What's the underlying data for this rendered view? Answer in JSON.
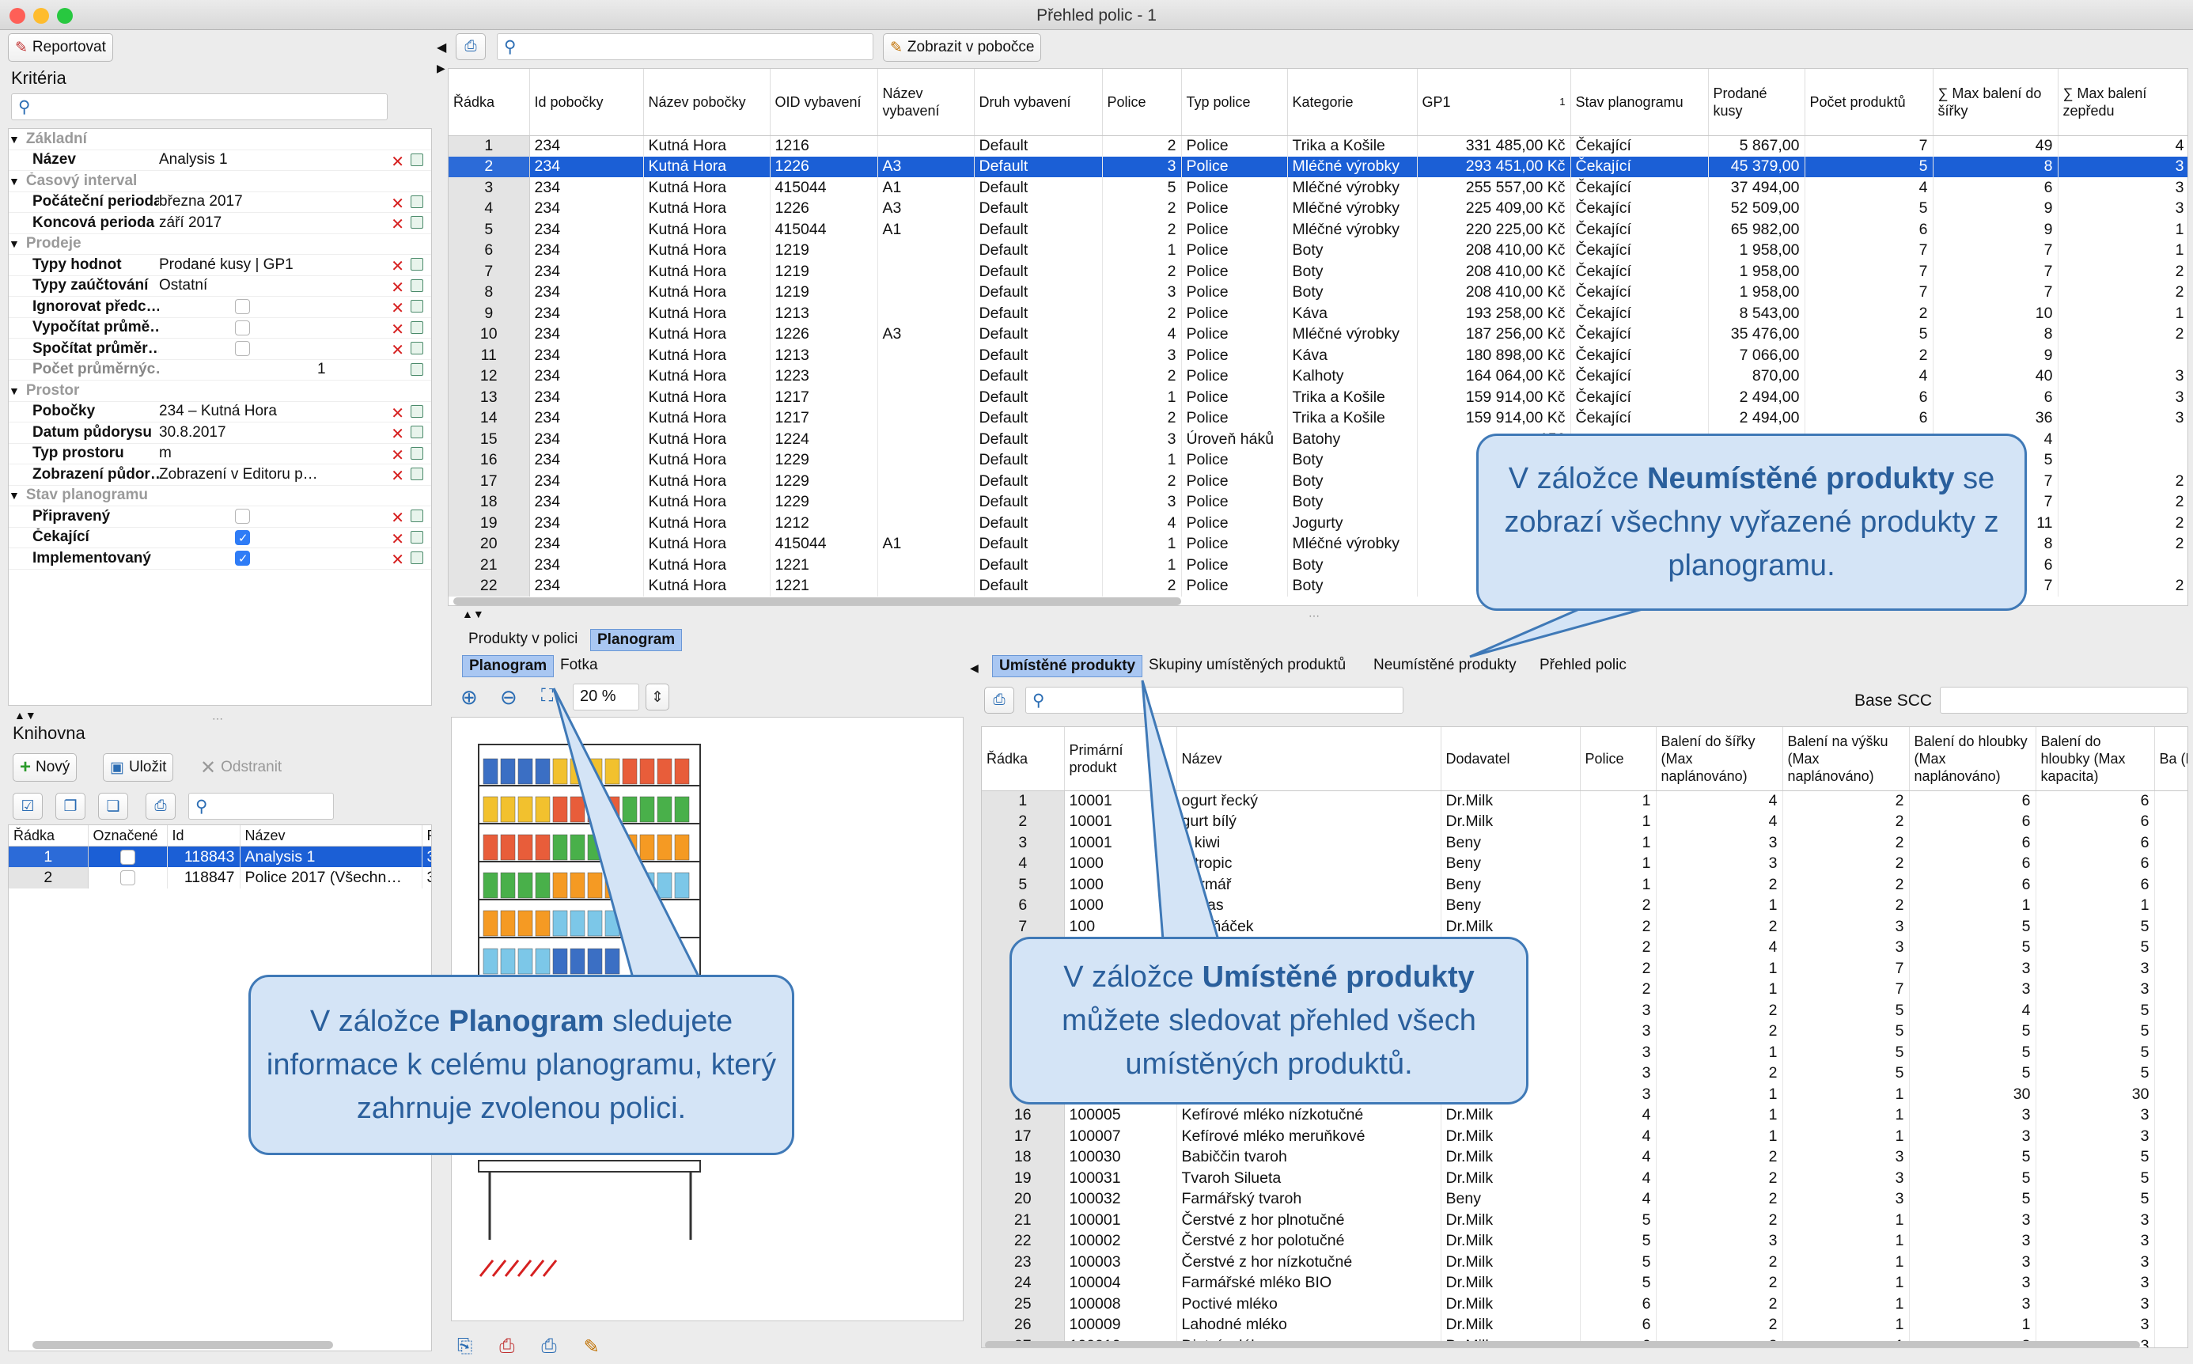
{
  "window": {
    "title": "Přehled polic - 1"
  },
  "toolbar": {
    "report_btn": "Reportovat",
    "show_in_branch": "Zobrazit v pobočce"
  },
  "criteria": {
    "title": "Kritéria",
    "rows": [
      {
        "type": "group",
        "label": "Základní"
      },
      {
        "type": "item",
        "label": "Název",
        "value": "Analysis 1"
      },
      {
        "type": "group",
        "label": "Časový interval"
      },
      {
        "type": "item",
        "label": "Počáteční perioda",
        "value": "března 2017"
      },
      {
        "type": "item",
        "label": "Koncová perioda",
        "value": "září 2017"
      },
      {
        "type": "group",
        "label": "Prodeje"
      },
      {
        "type": "item",
        "label": "Typy hodnot",
        "value": "Prodané kusy | GP1"
      },
      {
        "type": "item",
        "label": "Typy zaúčtování",
        "value": "Ostatní"
      },
      {
        "type": "item",
        "label": "Ignorovat předc…",
        "value": "",
        "checkbox": false
      },
      {
        "type": "item",
        "label": "Vypočítat průmě…",
        "value": "",
        "checkbox": false
      },
      {
        "type": "item",
        "label": "Spočítat průměr…",
        "value": "",
        "checkbox": false
      },
      {
        "type": "dim",
        "label": "Počet průměrnýc…",
        "value": "1"
      },
      {
        "type": "group",
        "label": "Prostor"
      },
      {
        "type": "item",
        "label": "Pobočky",
        "value": "234 – Kutná Hora"
      },
      {
        "type": "item",
        "label": "Datum půdorysu",
        "value": "30.8.2017"
      },
      {
        "type": "item",
        "label": "Typ prostoru",
        "value": "m"
      },
      {
        "type": "item",
        "label": "Zobrazení půdor…",
        "value": "Zobrazení v Editoru p…"
      },
      {
        "type": "group",
        "label": "Stav planogramu"
      },
      {
        "type": "item",
        "label": "Připravený",
        "value": "",
        "checkbox": false
      },
      {
        "type": "item",
        "label": "Čekající",
        "value": "",
        "checkbox": true
      },
      {
        "type": "item",
        "label": "Implementovaný",
        "value": "",
        "checkbox": true
      }
    ]
  },
  "library": {
    "title": "Knihovna",
    "new_btn": "Nový",
    "save_btn": "Uložit",
    "delete_btn": "Odstranit",
    "headers": [
      "Řádka",
      "Označené",
      "Id",
      "Název",
      "P"
    ],
    "rows": [
      {
        "n": "1",
        "id": "118843",
        "name": "Analysis 1",
        "p": "3"
      },
      {
        "n": "2",
        "id": "118847",
        "name": "Police 2017 (Všechn…",
        "p": "3"
      }
    ]
  },
  "main_table": {
    "headers": [
      "Řádka",
      "Id pobočky",
      "Název pobočky",
      "OID vybavení",
      "Název vybavení",
      "Druh vybavení",
      "Police",
      "Typ police",
      "Kategorie",
      "GP1",
      "Stav planogramu",
      "Prodané kusy",
      "Počet produktů",
      "∑ Max balení do šířky",
      "∑ Max balení zepředu"
    ],
    "gp1_sort": "1",
    "rows": [
      [
        "1",
        "234",
        "Kutná Hora",
        "1216",
        "",
        "Default",
        "2",
        "Police",
        "Trika a Košile",
        "331 485,00 Kč",
        "Čekající",
        "5 867,00",
        "7",
        "49",
        "4"
      ],
      [
        "2",
        "234",
        "Kutná Hora",
        "1226",
        "A3",
        "Default",
        "3",
        "Police",
        "Mléčné výrobky",
        "293 451,00 Kč",
        "Čekající",
        "45 379,00",
        "5",
        "8",
        "3"
      ],
      [
        "3",
        "234",
        "Kutná Hora",
        "415044",
        "A1",
        "Default",
        "5",
        "Police",
        "Mléčné výrobky",
        "255 557,00 Kč",
        "Čekající",
        "37 494,00",
        "4",
        "6",
        "3"
      ],
      [
        "4",
        "234",
        "Kutná Hora",
        "1226",
        "A3",
        "Default",
        "2",
        "Police",
        "Mléčné výrobky",
        "225 409,00 Kč",
        "Čekající",
        "52 509,00",
        "5",
        "9",
        "3"
      ],
      [
        "5",
        "234",
        "Kutná Hora",
        "415044",
        "A1",
        "Default",
        "2",
        "Police",
        "Mléčné výrobky",
        "220 225,00 Kč",
        "Čekající",
        "65 982,00",
        "6",
        "9",
        "1"
      ],
      [
        "6",
        "234",
        "Kutná Hora",
        "1219",
        "",
        "Default",
        "1",
        "Police",
        "Boty",
        "208 410,00 Kč",
        "Čekající",
        "1 958,00",
        "7",
        "7",
        "1"
      ],
      [
        "7",
        "234",
        "Kutná Hora",
        "1219",
        "",
        "Default",
        "2",
        "Police",
        "Boty",
        "208 410,00 Kč",
        "Čekající",
        "1 958,00",
        "7",
        "7",
        "2"
      ],
      [
        "8",
        "234",
        "Kutná Hora",
        "1219",
        "",
        "Default",
        "3",
        "Police",
        "Boty",
        "208 410,00 Kč",
        "Čekající",
        "1 958,00",
        "7",
        "7",
        "2"
      ],
      [
        "9",
        "234",
        "Kutná Hora",
        "1213",
        "",
        "Default",
        "2",
        "Police",
        "Káva",
        "193 258,00 Kč",
        "Čekající",
        "8 543,00",
        "2",
        "10",
        "1"
      ],
      [
        "10",
        "234",
        "Kutná Hora",
        "1226",
        "A3",
        "Default",
        "4",
        "Police",
        "Mléčné výrobky",
        "187 256,00 Kč",
        "Čekající",
        "35 476,00",
        "5",
        "8",
        "2"
      ],
      [
        "11",
        "234",
        "Kutná Hora",
        "1213",
        "",
        "Default",
        "3",
        "Police",
        "Káva",
        "180 898,00 Kč",
        "Čekající",
        "7 066,00",
        "2",
        "9",
        ""
      ],
      [
        "12",
        "234",
        "Kutná Hora",
        "1223",
        "",
        "Default",
        "2",
        "Police",
        "Kalhoty",
        "164 064,00 Kč",
        "Čekající",
        "870,00",
        "4",
        "40",
        "3"
      ],
      [
        "13",
        "234",
        "Kutná Hora",
        "1217",
        "",
        "Default",
        "1",
        "Police",
        "Trika a Košile",
        "159 914,00 Kč",
        "Čekající",
        "2 494,00",
        "6",
        "6",
        "3"
      ],
      [
        "14",
        "234",
        "Kutná Hora",
        "1217",
        "",
        "Default",
        "2",
        "Police",
        "Trika a Košile",
        "159 914,00 Kč",
        "Čekající",
        "2 494,00",
        "6",
        "36",
        "3"
      ],
      [
        "15",
        "234",
        "Kutná Hora",
        "1224",
        "",
        "Default",
        "3",
        "Úroveň háků",
        "Batohy",
        "156",
        "",
        "",
        "",
        "4",
        ""
      ],
      [
        "16",
        "234",
        "Kutná Hora",
        "1229",
        "",
        "Default",
        "1",
        "Police",
        "Boty",
        "15",
        "",
        "",
        "",
        "5",
        ""
      ],
      [
        "17",
        "234",
        "Kutná Hora",
        "1229",
        "",
        "Default",
        "2",
        "Police",
        "Boty",
        "15",
        "",
        "",
        "",
        "7",
        "2"
      ],
      [
        "18",
        "234",
        "Kutná Hora",
        "1229",
        "",
        "Default",
        "3",
        "Police",
        "Boty",
        "15",
        "",
        "",
        "",
        "7",
        "2"
      ],
      [
        "19",
        "234",
        "Kutná Hora",
        "1212",
        "",
        "Default",
        "4",
        "Police",
        "Jogurty",
        "15",
        "",
        "",
        "",
        "11",
        "2"
      ],
      [
        "20",
        "234",
        "Kutná Hora",
        "415044",
        "A1",
        "Default",
        "1",
        "Police",
        "Mléčné výrobky",
        "15",
        "",
        "",
        "",
        "8",
        "2"
      ],
      [
        "21",
        "234",
        "Kutná Hora",
        "1221",
        "",
        "Default",
        "1",
        "Police",
        "Boty",
        "15",
        "",
        "",
        "",
        "6",
        ""
      ],
      [
        "22",
        "234",
        "Kutná Hora",
        "1221",
        "",
        "Default",
        "2",
        "Police",
        "Boty",
        "15",
        "",
        "",
        "",
        "7",
        "2"
      ]
    ]
  },
  "tabs_top": [
    "Produkty v polici",
    "Planogram"
  ],
  "tabs_left": [
    "Planogram",
    "Fotka"
  ],
  "zoom": "20 %",
  "tabs_right": [
    "Umístěné produkty",
    "Skupiny umístěných produktů",
    "Neumístěné produkty",
    "Přehled polic"
  ],
  "base_scc": "Base SCC",
  "products_table": {
    "headers": [
      "Řádka",
      "Primární produkt",
      "Název",
      "Dodavatel",
      "Police",
      "Balení do šířky (Max naplánováno)",
      "Balení na výšku (Max naplánováno)",
      "Balení do hloubky (Max naplánováno)",
      "Balení do hloubky (Max kapacita)",
      "Ba (M na"
    ],
    "rows": [
      [
        "1",
        "10001",
        "ogurt řecký",
        "Dr.Milk",
        "1",
        "4",
        "2",
        "6",
        "6"
      ],
      [
        "2",
        "10001",
        "gurt bílý",
        "Dr.Milk",
        "1",
        "4",
        "2",
        "6",
        "6"
      ],
      [
        "3",
        "10001",
        "o kiwi",
        "Beny",
        "1",
        "3",
        "2",
        "6",
        "6"
      ],
      [
        "4",
        "1000",
        "o tropic",
        "Beny",
        "1",
        "3",
        "2",
        "6",
        "6"
      ],
      [
        "5",
        "1000",
        "Farmář",
        "Beny",
        "1",
        "2",
        "2",
        "6",
        "6"
      ],
      [
        "6",
        "1000",
        "nanas",
        "Beny",
        "2",
        "1",
        "2",
        "1",
        "1"
      ],
      [
        "7",
        "100",
        "Třešňáček",
        "Dr.Milk",
        "2",
        "2",
        "3",
        "5",
        "5"
      ],
      [
        "",
        "",
        "",
        "",
        "2",
        "4",
        "3",
        "5",
        "5"
      ],
      [
        "",
        "",
        "",
        "",
        "2",
        "1",
        "7",
        "3",
        "3"
      ],
      [
        "",
        "",
        "",
        "",
        "2",
        "1",
        "7",
        "3",
        "3"
      ],
      [
        "",
        "",
        "",
        "",
        "3",
        "2",
        "5",
        "4",
        "5"
      ],
      [
        "",
        "",
        "",
        "",
        "3",
        "2",
        "5",
        "5",
        "5"
      ],
      [
        "",
        "",
        "",
        "",
        "3",
        "1",
        "5",
        "5",
        "5"
      ],
      [
        "",
        "",
        "",
        "",
        "3",
        "2",
        "5",
        "5",
        "5"
      ],
      [
        "",
        "",
        "",
        "",
        "3",
        "1",
        "1",
        "30",
        "30"
      ],
      [
        "16",
        "100005",
        "Kefírové mléko nízkotučné",
        "Dr.Milk",
        "4",
        "1",
        "1",
        "3",
        "3"
      ],
      [
        "17",
        "100007",
        "Kefírové mléko meruňkové",
        "Dr.Milk",
        "4",
        "1",
        "1",
        "3",
        "3"
      ],
      [
        "18",
        "100030",
        "Babiččin tvaroh",
        "Dr.Milk",
        "4",
        "2",
        "3",
        "5",
        "5"
      ],
      [
        "19",
        "100031",
        "Tvaroh Silueta",
        "Dr.Milk",
        "4",
        "2",
        "3",
        "5",
        "5"
      ],
      [
        "20",
        "100032",
        "Farmářský tvaroh",
        "Beny",
        "4",
        "2",
        "3",
        "5",
        "5"
      ],
      [
        "21",
        "100001",
        "Čerstvé z hor plnotučné",
        "Dr.Milk",
        "5",
        "2",
        "1",
        "3",
        "3"
      ],
      [
        "22",
        "100002",
        "Čerstvé z hor polotučné",
        "Dr.Milk",
        "5",
        "3",
        "1",
        "3",
        "3"
      ],
      [
        "23",
        "100003",
        "Čerstvé z hor nízkotučné",
        "Dr.Milk",
        "5",
        "2",
        "1",
        "3",
        "3"
      ],
      [
        "24",
        "100004",
        "Farmářské mléko BIO",
        "Dr.Milk",
        "5",
        "2",
        "1",
        "3",
        "3"
      ],
      [
        "25",
        "100008",
        "Poctivé mléko",
        "Dr.Milk",
        "6",
        "2",
        "1",
        "3",
        "3"
      ],
      [
        "26",
        "100009",
        "Lahodné mléko",
        "Dr.Milk",
        "6",
        "2",
        "1",
        "1",
        "3"
      ],
      [
        "27",
        "100010",
        "Dietní mléko",
        "Dr.Milk",
        "6",
        "2",
        "1",
        "3",
        "3"
      ]
    ]
  },
  "callouts": {
    "unplaced": {
      "pre": "V záložce ",
      "bold": "Neumístěné produkty",
      "post": " se zobrazí všechny vyřazené produkty z planogramu."
    },
    "planogram": {
      "pre": "V záložce ",
      "bold": "Planogram",
      "post": " sledujete informace k celému planogramu, který zahrnuje zvolenou polici."
    },
    "placed": {
      "pre": "V záložce ",
      "bold": "Umístěné produkty",
      "post": " můžete sledovat přehled všech umístěných produktů."
    }
  }
}
